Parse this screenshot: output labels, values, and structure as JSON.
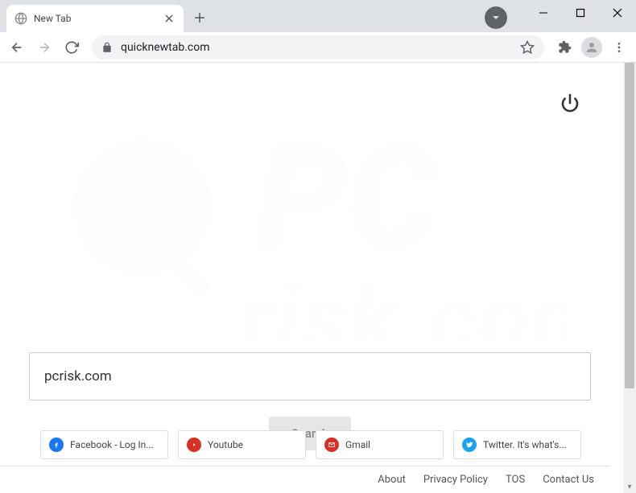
{
  "window": {
    "tab_title": "New Tab"
  },
  "toolbar": {
    "url": "quicknewtab.com"
  },
  "page": {
    "search_value": "pcrisk.com",
    "search_button": "Search"
  },
  "quick_links": [
    {
      "label": "Facebook - Log In...",
      "icon": "fb"
    },
    {
      "label": "Youtube",
      "icon": "yt"
    },
    {
      "label": "Gmail",
      "icon": "gm"
    },
    {
      "label": "Twitter. It's what's...",
      "icon": "tw"
    }
  ],
  "footer": {
    "about": "About",
    "privacy": "Privacy Policy",
    "tos": "TOS",
    "contact": "Contact Us"
  }
}
